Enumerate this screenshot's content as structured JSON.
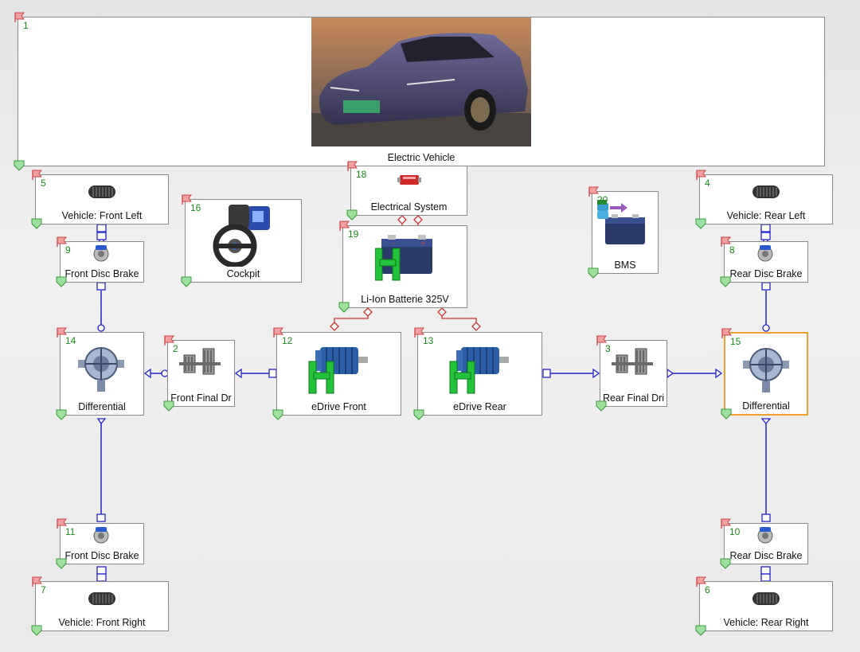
{
  "blocks": [
    {
      "id": "b1",
      "num": "1",
      "label": "Electric Vehicle",
      "icon": "car-photo"
    },
    {
      "id": "b5",
      "num": "5",
      "label": "Vehicle: Front Left",
      "icon": "tire-icon"
    },
    {
      "id": "b4",
      "num": "4",
      "label": "Vehicle: Rear Left",
      "icon": "tire-icon"
    },
    {
      "id": "b16",
      "num": "16",
      "label": "Cockpit",
      "icon": "steering-wheel-icon"
    },
    {
      "id": "b18",
      "num": "18",
      "label": "Electrical System",
      "icon": "connector-icon"
    },
    {
      "id": "b19",
      "num": "19",
      "label": "Li-Ion Batterie 325V",
      "icon": "battery-icon"
    },
    {
      "id": "b20",
      "num": "20",
      "label": "BMS",
      "icon": "bms-icon"
    },
    {
      "id": "b9",
      "num": "9",
      "label": "Front Disc Brake",
      "icon": "disc-brake-icon"
    },
    {
      "id": "b8",
      "num": "8",
      "label": "Rear Disc Brake",
      "icon": "disc-brake-icon"
    },
    {
      "id": "b14",
      "num": "14",
      "label": "Differential",
      "icon": "differential-icon"
    },
    {
      "id": "b2",
      "num": "2",
      "label": "Front Final Dr",
      "icon": "gear-pair-icon"
    },
    {
      "id": "b12",
      "num": "12",
      "label": "eDrive Front",
      "icon": "electric-motor-icon"
    },
    {
      "id": "b13",
      "num": "13",
      "label": "eDrive Rear",
      "icon": "electric-motor-icon"
    },
    {
      "id": "b3",
      "num": "3",
      "label": "Rear Final Dri",
      "icon": "gear-pair-icon"
    },
    {
      "id": "b15",
      "num": "15",
      "label": "Differential",
      "icon": "differential-icon"
    },
    {
      "id": "b11",
      "num": "11",
      "label": "Front Disc Brake",
      "icon": "disc-brake-icon"
    },
    {
      "id": "b10",
      "num": "10",
      "label": "Rear Disc Brake",
      "icon": "disc-brake-icon"
    },
    {
      "id": "b7",
      "num": "7",
      "label": "Vehicle: Front Right",
      "icon": "tire-icon"
    },
    {
      "id": "b6",
      "num": "6",
      "label": "Vehicle: Rear Right",
      "icon": "tire-icon"
    }
  ],
  "selected_block": "b15",
  "colors": {
    "mechanical_link": "#2222cc",
    "electrical_link": "#d03030",
    "number": "#1a8a1a",
    "selection": "#f0a030"
  }
}
